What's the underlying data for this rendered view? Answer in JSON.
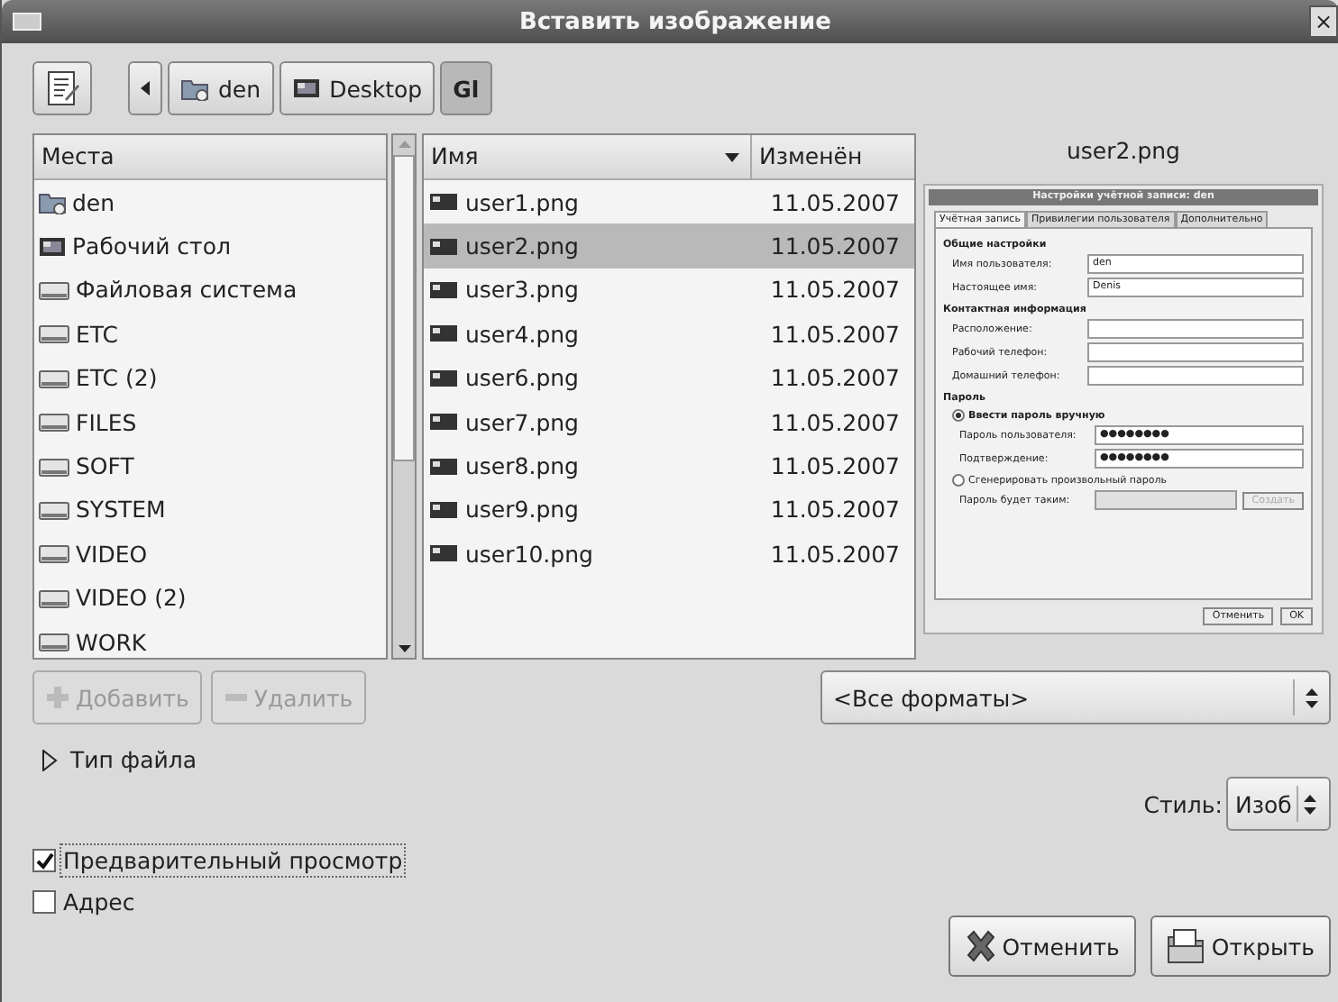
{
  "window": {
    "title": "Вставить изображение",
    "close": "×"
  },
  "path_bar": {
    "buttons": [
      {
        "label": "den",
        "kind": "home",
        "selected": false
      },
      {
        "label": "Desktop",
        "kind": "desktop",
        "selected": false
      },
      {
        "label": "Gl",
        "kind": "plain",
        "selected": true
      }
    ]
  },
  "places": {
    "header": "Места",
    "items": [
      {
        "label": "den",
        "kind": "home"
      },
      {
        "label": "Рабочий стол",
        "kind": "desktop"
      },
      {
        "label": "Файловая система",
        "kind": "drive"
      },
      {
        "label": "ETC",
        "kind": "drive"
      },
      {
        "label": "ETC (2)",
        "kind": "drive"
      },
      {
        "label": "FILES",
        "kind": "drive"
      },
      {
        "label": "SOFT",
        "kind": "drive"
      },
      {
        "label": "SYSTEM",
        "kind": "drive"
      },
      {
        "label": "VIDEO",
        "kind": "drive"
      },
      {
        "label": "VIDEO (2)",
        "kind": "drive"
      },
      {
        "label": "WORK",
        "kind": "drive"
      }
    ]
  },
  "files": {
    "columns": [
      "Имя",
      "Изменён"
    ],
    "rows": [
      {
        "name": "user1.png",
        "date": "11.05.2007",
        "selected": false
      },
      {
        "name": "user2.png",
        "date": "11.05.2007",
        "selected": true
      },
      {
        "name": "user3.png",
        "date": "11.05.2007",
        "selected": false
      },
      {
        "name": "user4.png",
        "date": "11.05.2007",
        "selected": false
      },
      {
        "name": "user6.png",
        "date": "11.05.2007",
        "selected": false
      },
      {
        "name": "user7.png",
        "date": "11.05.2007",
        "selected": false
      },
      {
        "name": "user8.png",
        "date": "11.05.2007",
        "selected": false
      },
      {
        "name": "user9.png",
        "date": "11.05.2007",
        "selected": false
      },
      {
        "name": "user10.png",
        "date": "11.05.2007",
        "selected": false
      }
    ]
  },
  "preview": {
    "title": "user2.png",
    "shot": {
      "title": "Настройки учётной записи: den",
      "tabs": [
        {
          "label": "Учётная запись",
          "selected": true
        },
        {
          "label": "Привилегии пользователя",
          "selected": false
        },
        {
          "label": "Дополнительно",
          "selected": false
        }
      ],
      "sections": [
        {
          "heading": "Общие настройки",
          "fields": [
            {
              "label": "Имя пользователя:",
              "value": "den"
            },
            {
              "label": "Настоящее имя:",
              "value": "Denis"
            }
          ]
        },
        {
          "heading": "Контактная информация",
          "fields": [
            {
              "label": "Расположение:"
            },
            {
              "label": "Рабочий телефон:"
            },
            {
              "label": "Домашний телефон:"
            }
          ]
        },
        {
          "heading": "Пароль",
          "radios": [
            {
              "label": "Ввести пароль вручную",
              "selected": true,
              "fields": [
                {
                  "label": "Пароль пользователя:",
                  "value": "●●●●●●●●"
                },
                {
                  "label": "Подтверждение:",
                  "value": "●●●●●●●●"
                }
              ]
            },
            {
              "label": "Сгенерировать произвольный пароль",
              "selected": false,
              "fields": [
                {
                  "label": "Пароль будет таким:",
                  "button": "Создать"
                }
              ]
            }
          ]
        }
      ],
      "buttons": [
        "Отменить",
        "OK"
      ]
    }
  },
  "place_buttons": [
    {
      "label": "Добавить",
      "kind": "plus",
      "disabled": true
    },
    {
      "label": "Удалить",
      "kind": "minus",
      "disabled": true
    }
  ],
  "filter": {
    "value": "<Все форматы>"
  },
  "expander": {
    "label": "Тип файла",
    "expanded": false
  },
  "style": {
    "label": "Стиль:",
    "value": "Изоб"
  },
  "checkboxes": [
    {
      "label": "Предварительный просмотр",
      "checked": true
    },
    {
      "label": "Адрес",
      "checked": false
    }
  ],
  "actions": [
    {
      "label": "Отменить",
      "kind": "cancel"
    },
    {
      "label": "Открыть",
      "kind": "open"
    }
  ]
}
